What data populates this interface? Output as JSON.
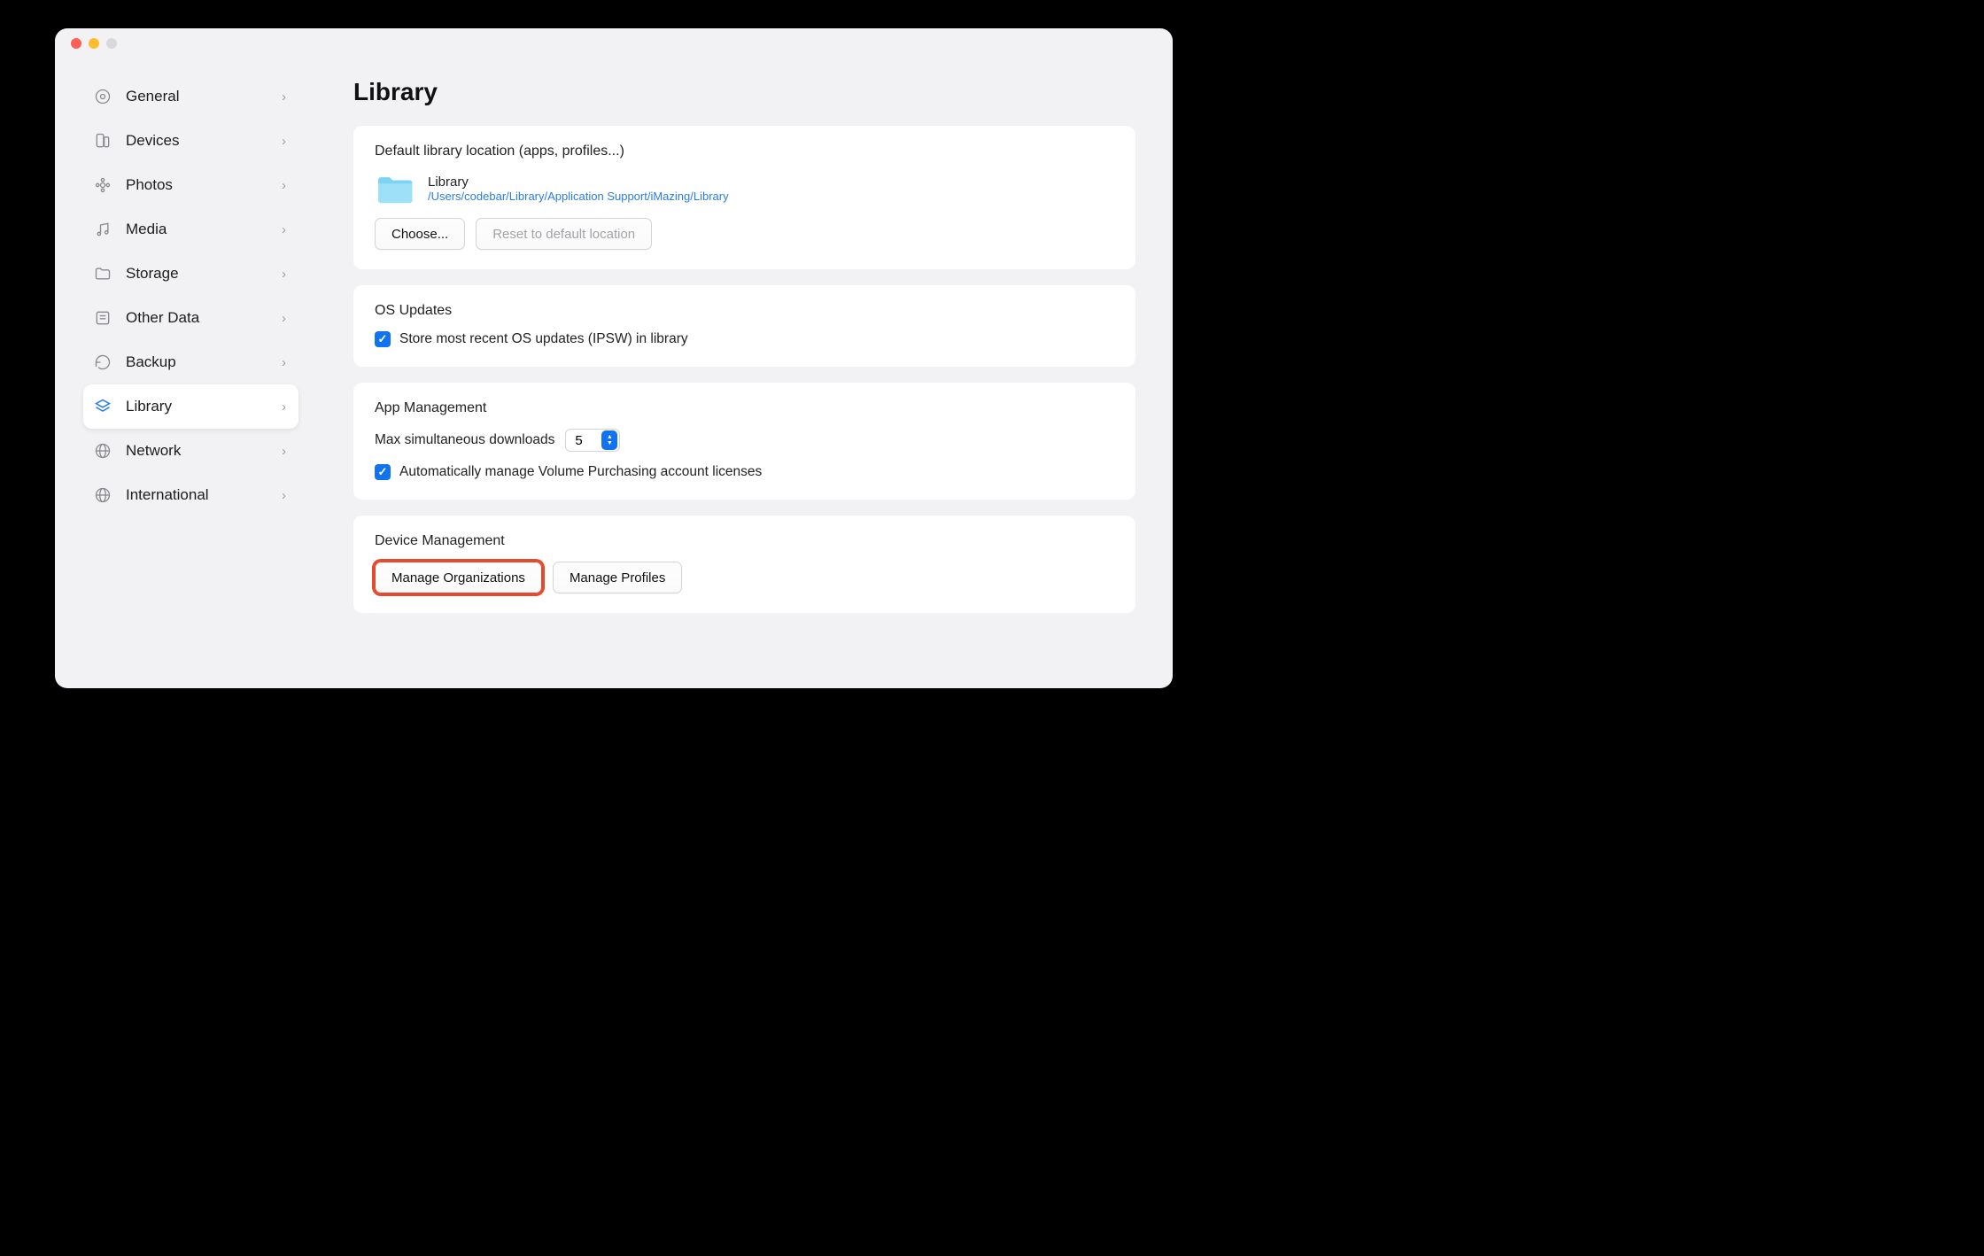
{
  "sidebar": {
    "items": [
      {
        "label": "General"
      },
      {
        "label": "Devices"
      },
      {
        "label": "Photos"
      },
      {
        "label": "Media"
      },
      {
        "label": "Storage"
      },
      {
        "label": "Other Data"
      },
      {
        "label": "Backup"
      },
      {
        "label": "Library"
      },
      {
        "label": "Network"
      },
      {
        "label": "International"
      }
    ],
    "active_index": 7
  },
  "page": {
    "title": "Library"
  },
  "library_location": {
    "section_label": "Default library location (apps, profiles...)",
    "folder_name": "Library",
    "folder_path": "/Users/codebar/Library/Application Support/iMazing/Library",
    "choose_label": "Choose...",
    "reset_label": "Reset to default location"
  },
  "os_updates": {
    "section_label": "OS Updates",
    "store_label": "Store most recent OS updates (IPSW) in library",
    "store_checked": true
  },
  "app_management": {
    "section_label": "App Management",
    "max_downloads_label": "Max simultaneous downloads",
    "max_downloads_value": "5",
    "auto_manage_label": "Automatically manage Volume Purchasing account licenses",
    "auto_manage_checked": true
  },
  "device_management": {
    "section_label": "Device Management",
    "manage_orgs_label": "Manage Organizations",
    "manage_profiles_label": "Manage Profiles"
  }
}
